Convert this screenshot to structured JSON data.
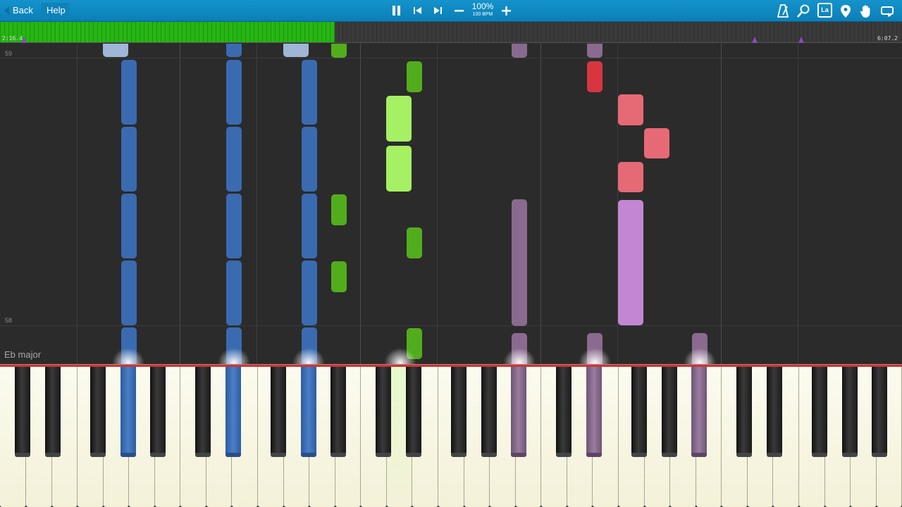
{
  "toolbar": {
    "back_label": "Back",
    "help_label": "Help",
    "tempo_percent": "100%",
    "tempo_bpm": "100 BPM",
    "icons": [
      "pause-icon",
      "skip-back-icon",
      "skip-forward-icon",
      "minus-icon",
      "plus-icon",
      "metronome-icon",
      "search-icon",
      "label-icon",
      "location-pin-icon",
      "hand-icon",
      "loop-icon"
    ],
    "label_icon_text": "La"
  },
  "progress": {
    "current_time": "2:16.4",
    "total_time": "6:07.2",
    "fraction": 0.371,
    "colors": {
      "fill": "#26b614",
      "marker": "#8a4bbd"
    }
  },
  "roll": {
    "measure_numbers": [
      "59",
      "58"
    ],
    "key_signature": "Eb major"
  },
  "colors": {
    "blue": "#3a6bb0",
    "green": "#52ad1c",
    "light_green": "#a6f064",
    "purple": "#8a6a8e",
    "red": "#d93540",
    "salmon": "#e66a75",
    "pink": "#c386d2",
    "ghost": "#9fb6d6"
  }
}
